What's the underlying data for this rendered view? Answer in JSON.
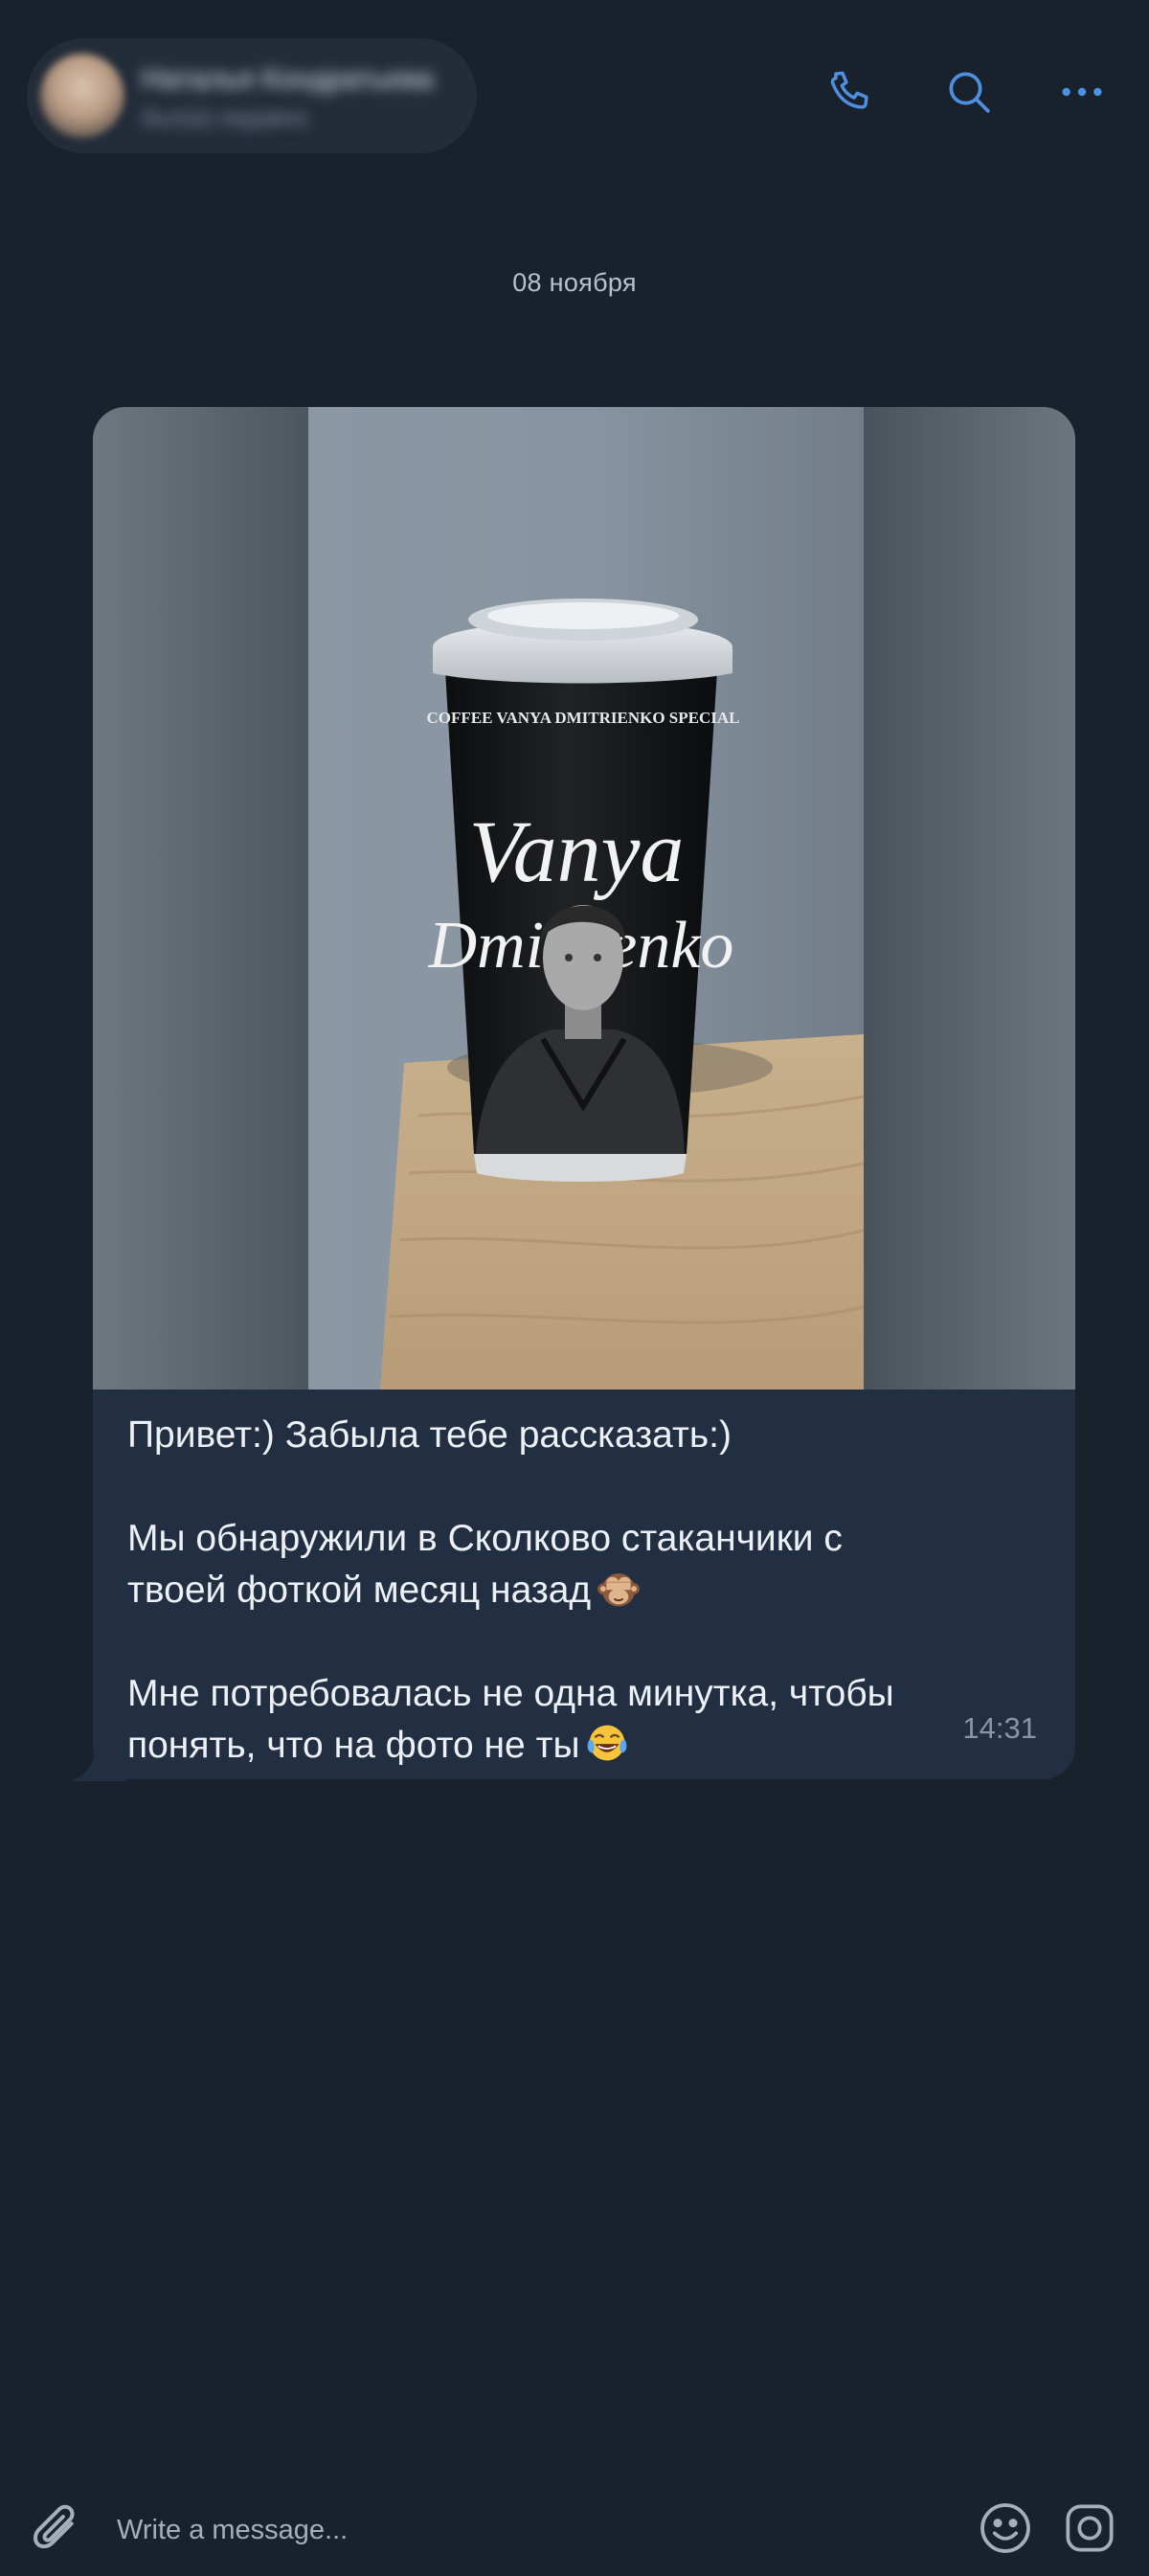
{
  "header": {
    "contact_name": "Наталья Кондратьева",
    "contact_status": "был(а) недавно",
    "icons": [
      "phone-icon",
      "search-icon",
      "more-icon"
    ],
    "accent_color": "#4f8fe0"
  },
  "chat": {
    "date_separator": "08 ноября",
    "message": {
      "photo": {
        "cup_brand_line": "COFFEE  VANYA DMITRIENKO  SPECIAL",
        "cup_title_line1": "Vanya",
        "cup_title_line2": "Dmitrienko"
      },
      "line1": "Привет:) Забыла тебе рассказать:)",
      "line2": "Мы обнаружили в Сколково стаканчики с",
      "line3": "твоей фоткой месяц назад",
      "line4": "Мне потребовалась не одна минутка, чтобы",
      "line5": "понять, что на фото не ты",
      "emoji1": "see-no-evil-monkey",
      "emoji2": "tears-of-joy",
      "time": "14:31"
    }
  },
  "composer": {
    "placeholder": "Write a message...",
    "icons": [
      "paperclip-icon",
      "emoji-icon",
      "camera-icon"
    ]
  },
  "colors": {
    "background": "#19212d",
    "bubble": "#222f42",
    "accent": "#4f8fe0"
  }
}
